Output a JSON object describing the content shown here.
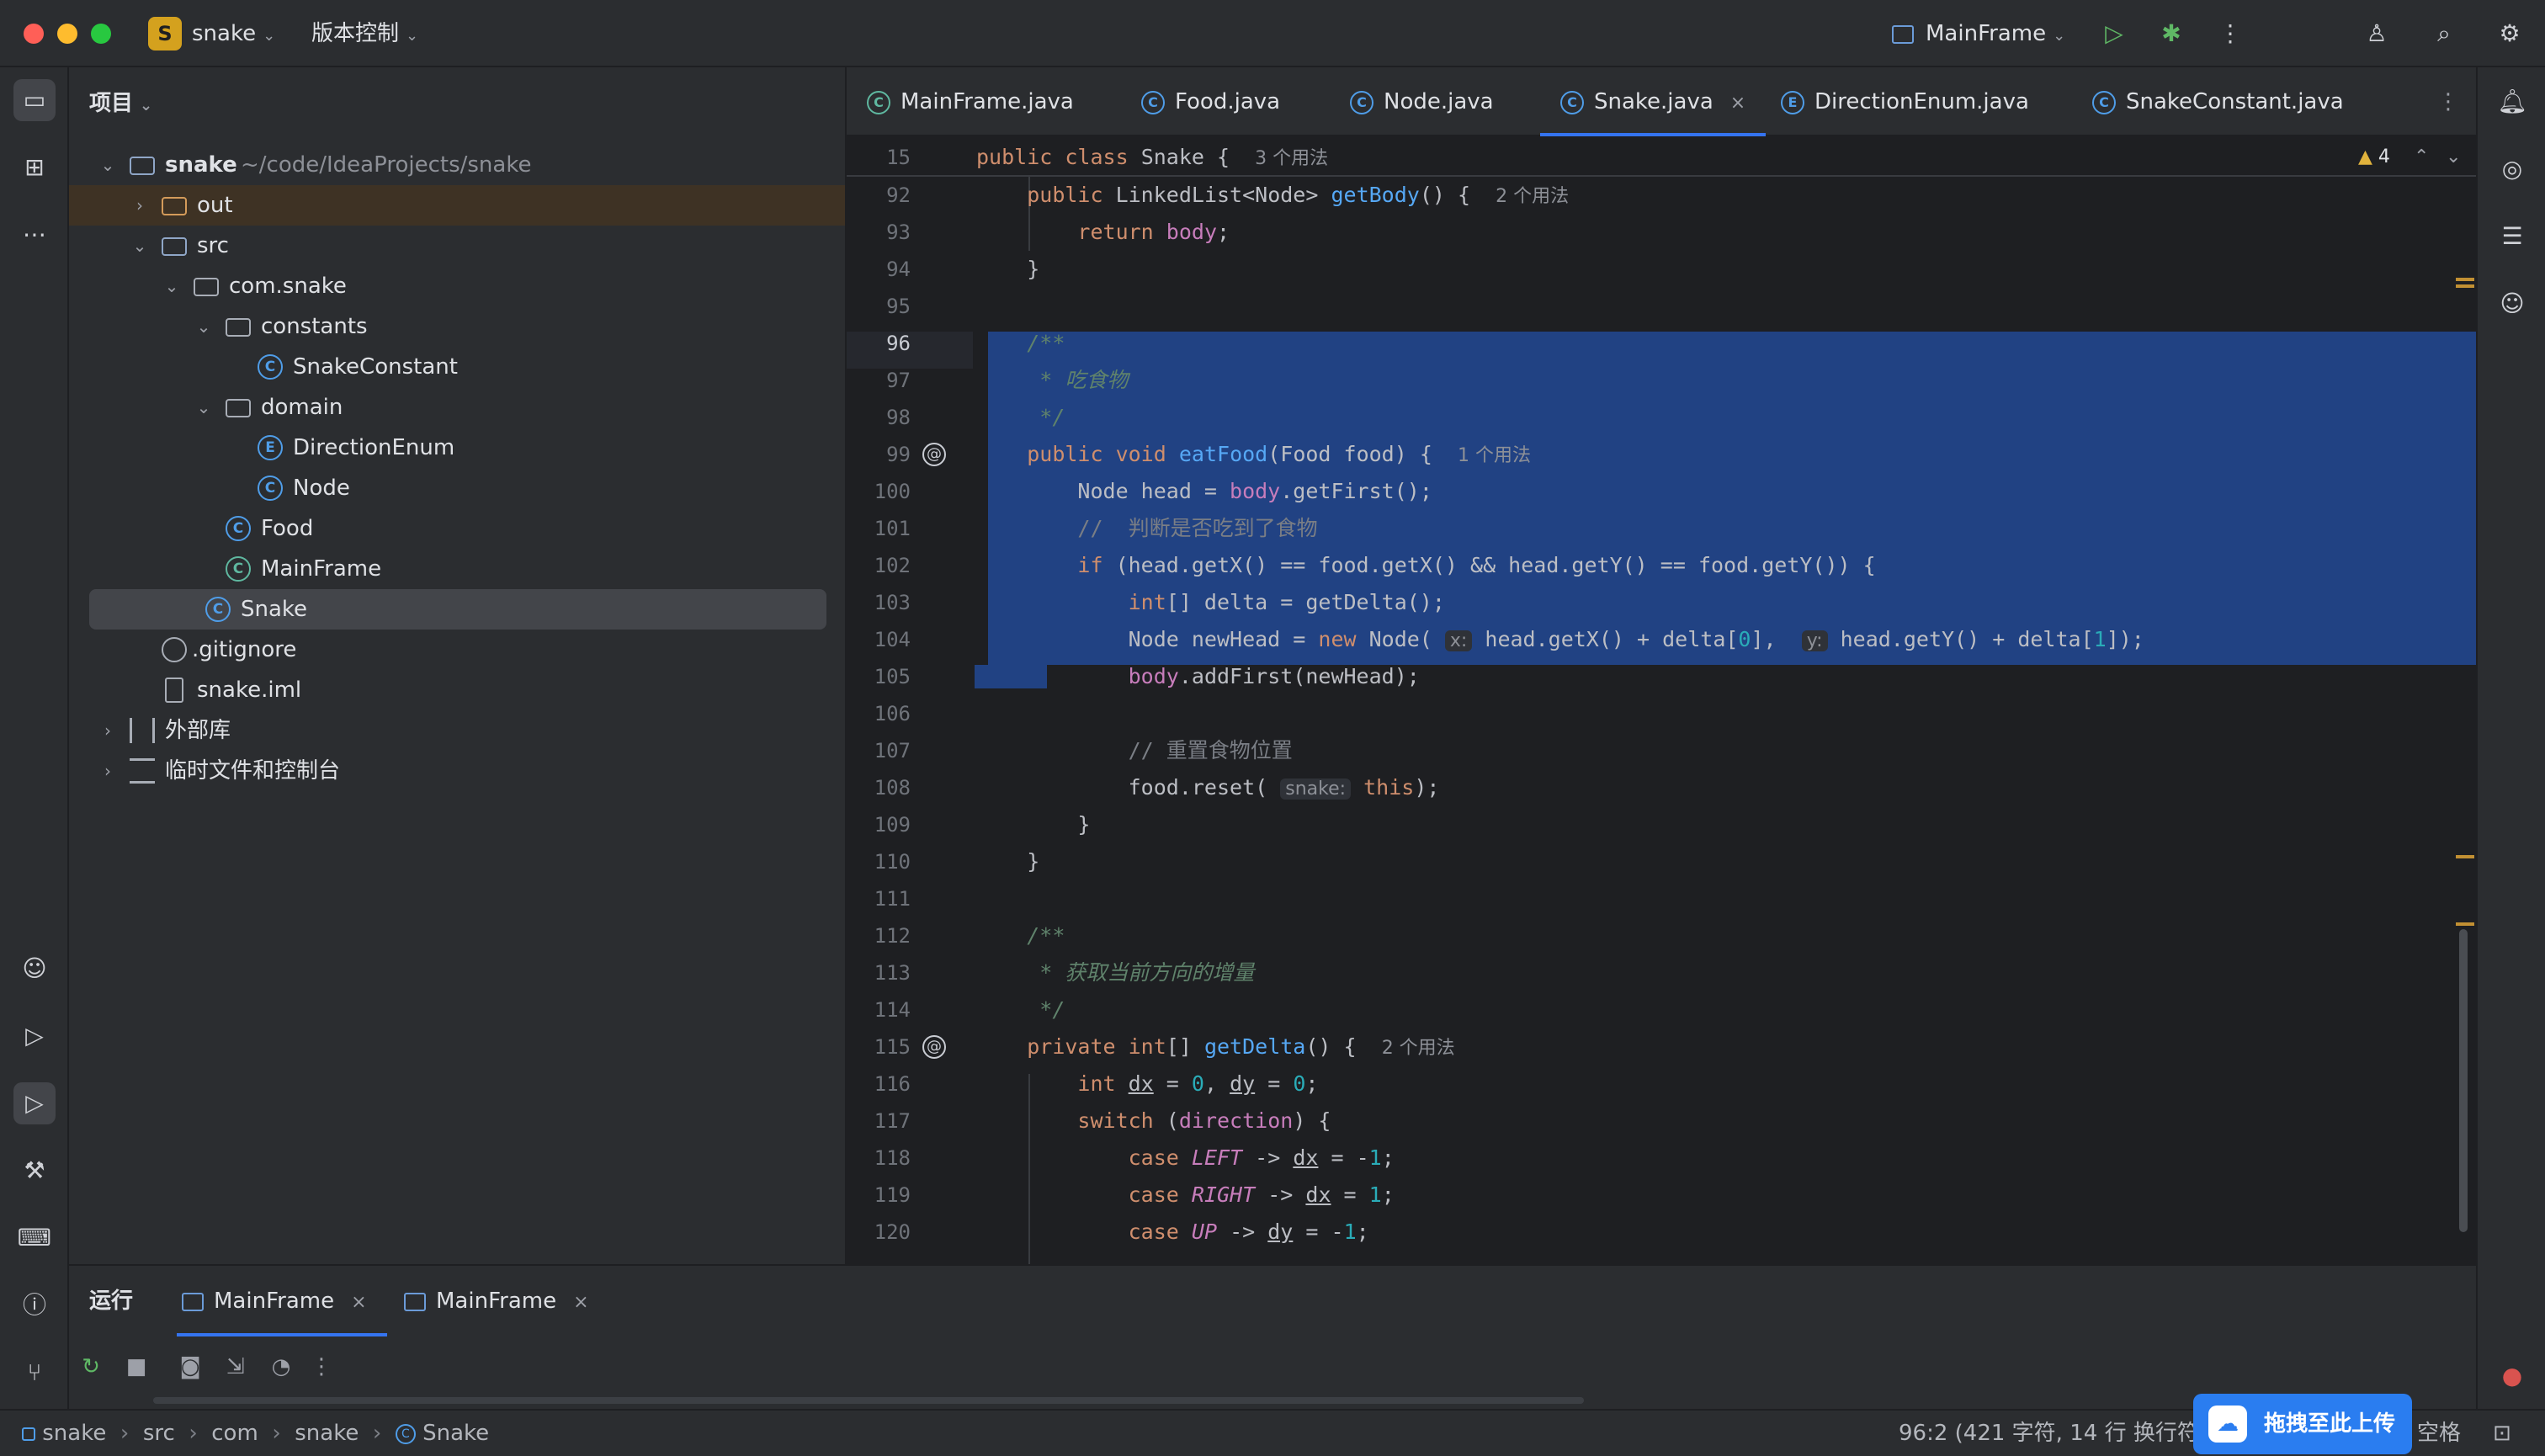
{
  "titlebar": {
    "project_badge": "S",
    "project_name": "snake",
    "vcs": "版本控制",
    "run_config": "MainFrame"
  },
  "project_panel": {
    "title": "项目",
    "tree": [
      {
        "name": "snake",
        "path": "~/code/IdeaProjects/snake"
      },
      {
        "name": "out"
      },
      {
        "name": "src"
      },
      {
        "name": "com.snake"
      },
      {
        "name": "constants"
      },
      {
        "name": "SnakeConstant"
      },
      {
        "name": "domain"
      },
      {
        "name": "DirectionEnum"
      },
      {
        "name": "Node"
      },
      {
        "name": "Food"
      },
      {
        "name": "MainFrame"
      },
      {
        "name": "Snake"
      },
      {
        "name": ".gitignore"
      },
      {
        "name": "snake.iml"
      },
      {
        "name": "外部库"
      },
      {
        "name": "临时文件和控制台"
      }
    ]
  },
  "tabs": [
    {
      "label": "MainFrame.java"
    },
    {
      "label": "Food.java"
    },
    {
      "label": "Node.java"
    },
    {
      "label": "Snake.java"
    },
    {
      "label": "DirectionEnum.java"
    },
    {
      "label": "SnakeConstant.java"
    }
  ],
  "editor": {
    "sticky_line_number": "15",
    "sticky_kw1": "public",
    "sticky_kw2": "class",
    "sticky_name": "Snake {",
    "sticky_hint": "3 个用法",
    "warnings": "4",
    "line_numbers": [
      "92",
      "93",
      "94",
      "95",
      "96",
      "97",
      "98",
      "99",
      "100",
      "101",
      "102",
      "103",
      "104",
      "105",
      "106",
      "107",
      "108",
      "109",
      "110",
      "111",
      "112",
      "113",
      "114",
      "115",
      "116",
      "117",
      "118",
      "119",
      "120"
    ],
    "hints": {
      "getBody": "2 个用法",
      "eatFood": "1 个用法",
      "getDelta": "2 个用法",
      "x": "x:",
      "y": "y:",
      "snake": "snake:"
    },
    "comments": {
      "doc_open": "/**",
      "eat_food": " * 吃食物",
      "doc_close": " */",
      "check_food": "//  判断是否吃到了食物",
      "reset_food": "// 重置食物位置",
      "get_delta": " * 获取当前方向的增量"
    }
  },
  "run_panel": {
    "title": "运行",
    "tabs": [
      {
        "label": "MainFrame"
      },
      {
        "label": "MainFrame"
      }
    ]
  },
  "statusbar": {
    "breadcrumb": [
      "snake",
      "src",
      "com",
      "snake",
      "Snake"
    ],
    "position": "96:2 (421 字符, 14 行 换行符",
    "indent": "空格",
    "upload": "拖拽至此上传"
  }
}
